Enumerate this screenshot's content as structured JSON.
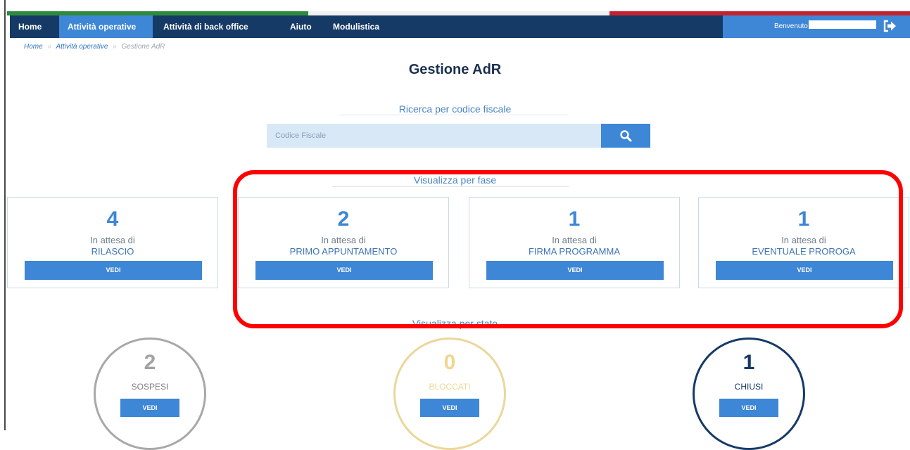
{
  "colors": {
    "nav_background": "#163a66",
    "accent": "#3e86d6",
    "highlight": "#ff0000",
    "flag_green": "#2f8a3e",
    "flag_red": "#c3232f",
    "state_sospesi": "#a8a8a8",
    "state_bloccati": "#ead79a",
    "state_chiusi": "#163a66"
  },
  "nav": {
    "items": [
      {
        "label": "Home"
      },
      {
        "label": "Attività operative",
        "active": true
      },
      {
        "label": "Attività di back office"
      },
      {
        "label": "Aiuto"
      },
      {
        "label": "Modulistica"
      }
    ],
    "welcome": "Benvenuto",
    "logout_icon": "sign-out-icon"
  },
  "breadcrumb": {
    "home": "Home",
    "section": "Attività operative",
    "current": "Gestione AdR",
    "separator": "»"
  },
  "page": {
    "title": "Gestione AdR"
  },
  "search": {
    "label": "Ricerca per codice fiscale",
    "placeholder": "Codice Fiscale",
    "value": "",
    "icon": "search-icon"
  },
  "phases": {
    "label": "Visualizza per fase",
    "cards": [
      {
        "count": "4",
        "prefix": "In attesa di",
        "name": "RILASCIO",
        "button": "VEDI"
      },
      {
        "count": "2",
        "prefix": "In attesa di",
        "name": "PRIMO APPUNTAMENTO",
        "button": "VEDI"
      },
      {
        "count": "1",
        "prefix": "In attesa di",
        "name": "FIRMA PROGRAMMA",
        "button": "VEDI"
      },
      {
        "count": "1",
        "prefix": "In attesa di",
        "name": "EVENTUALE PROROGA",
        "button": "VEDI"
      }
    ]
  },
  "states": {
    "label": "Visualizza per stato",
    "items": [
      {
        "count": "2",
        "name": "SOSPESI",
        "button": "VEDI"
      },
      {
        "count": "0",
        "name": "BLOCCATI",
        "button": "VEDI"
      },
      {
        "count": "1",
        "name": "CHIUSI",
        "button": "VEDI"
      }
    ]
  }
}
